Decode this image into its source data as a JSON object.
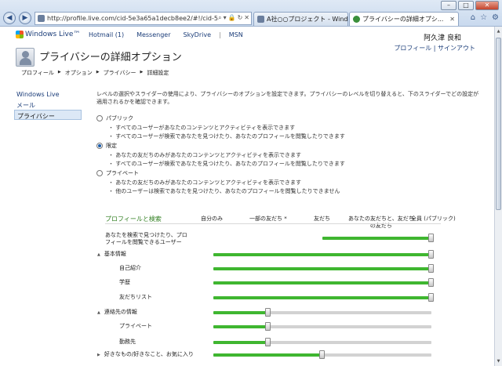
{
  "browser": {
    "address": "http://profile.live.com/cid-5e3a65a1decb8ee2/#!/cid-5e3a6",
    "tabs": [
      {
        "label": "A社○○プロジェクト - Wind..."
      },
      {
        "label": "プライバシーの詳細オプシ..."
      }
    ],
    "window_controls": {
      "minimize": "–",
      "maximize": "□",
      "close": "✕"
    }
  },
  "header": {
    "brand": "Windows Live™",
    "nav": [
      "Hotmail (1)",
      "Messenger",
      "SkyDrive",
      "MSN"
    ],
    "user_name": "阿久津 良和",
    "user_menu": "プロフィール | サインアウト"
  },
  "page": {
    "title": "プライバシーの詳細オプション",
    "breadcrumb": [
      "プロフィール",
      "オプション",
      "プライバシー",
      "詳細設定"
    ]
  },
  "sidebar": {
    "items": [
      {
        "label": "Windows Live"
      },
      {
        "label": "メール"
      },
      {
        "label": "プライバシー"
      }
    ]
  },
  "main": {
    "intro": "レベルの選択やスライダーの使用により、プライバシーのオプションを設定できます。プライバシーのレベルを切り替えると、下のスライダーでどの設定が適用されるかを確認できます。",
    "options": [
      {
        "label": "パブリック",
        "selected": false,
        "bullets": [
          "すべてのユーザーがあなたのコンテンツとアクティビティを表示できます",
          "すべてのユーザーが検索であなたを見つけたり、あなたのプロフィールを閲覧したりできます"
        ]
      },
      {
        "label": "限定",
        "selected": true,
        "bullets": [
          "あなたの友だちのみがあなたのコンテンツとアクティビティを表示できます",
          "すべてのユーザーが検索であなたを見つけたり、あなたのプロフィールを閲覧したりできます"
        ]
      },
      {
        "label": "プライベート",
        "selected": false,
        "bullets": [
          "あなたの友だちのみがあなたのコンテンツとアクティビティを表示できます",
          "他のユーザーは検索であなたを見つけたり、あなたのプロフィールを閲覧したりできません"
        ]
      }
    ],
    "section_title": "プロフィールと検索",
    "columns": [
      "自分のみ",
      "一部の友だち *",
      "友だち",
      "あなたの友だちと、友だち\nの友だち",
      "全員 (パブリック)"
    ],
    "rows": [
      {
        "label": "あなたを検索で見つけたり、プロフィールを閲覧できるユーザー",
        "level": 1.0,
        "range_start": 0.5
      },
      {
        "label": "基本情報",
        "level": 1.0,
        "expander": "▲"
      },
      {
        "label": "自己紹介",
        "level": 1.0
      },
      {
        "label": "学歴",
        "level": 1.0
      },
      {
        "label": "友だちリスト",
        "level": 1.0
      },
      {
        "label": "連絡先の情報",
        "level": 0.25,
        "expander": "▲"
      },
      {
        "label": "プライベート",
        "level": 0.25
      },
      {
        "label": "勤務先",
        "level": 0.25
      },
      {
        "label": "好きなもの/好きなこと、お気に入り",
        "level": 0.5,
        "expander": "▶"
      }
    ]
  }
}
